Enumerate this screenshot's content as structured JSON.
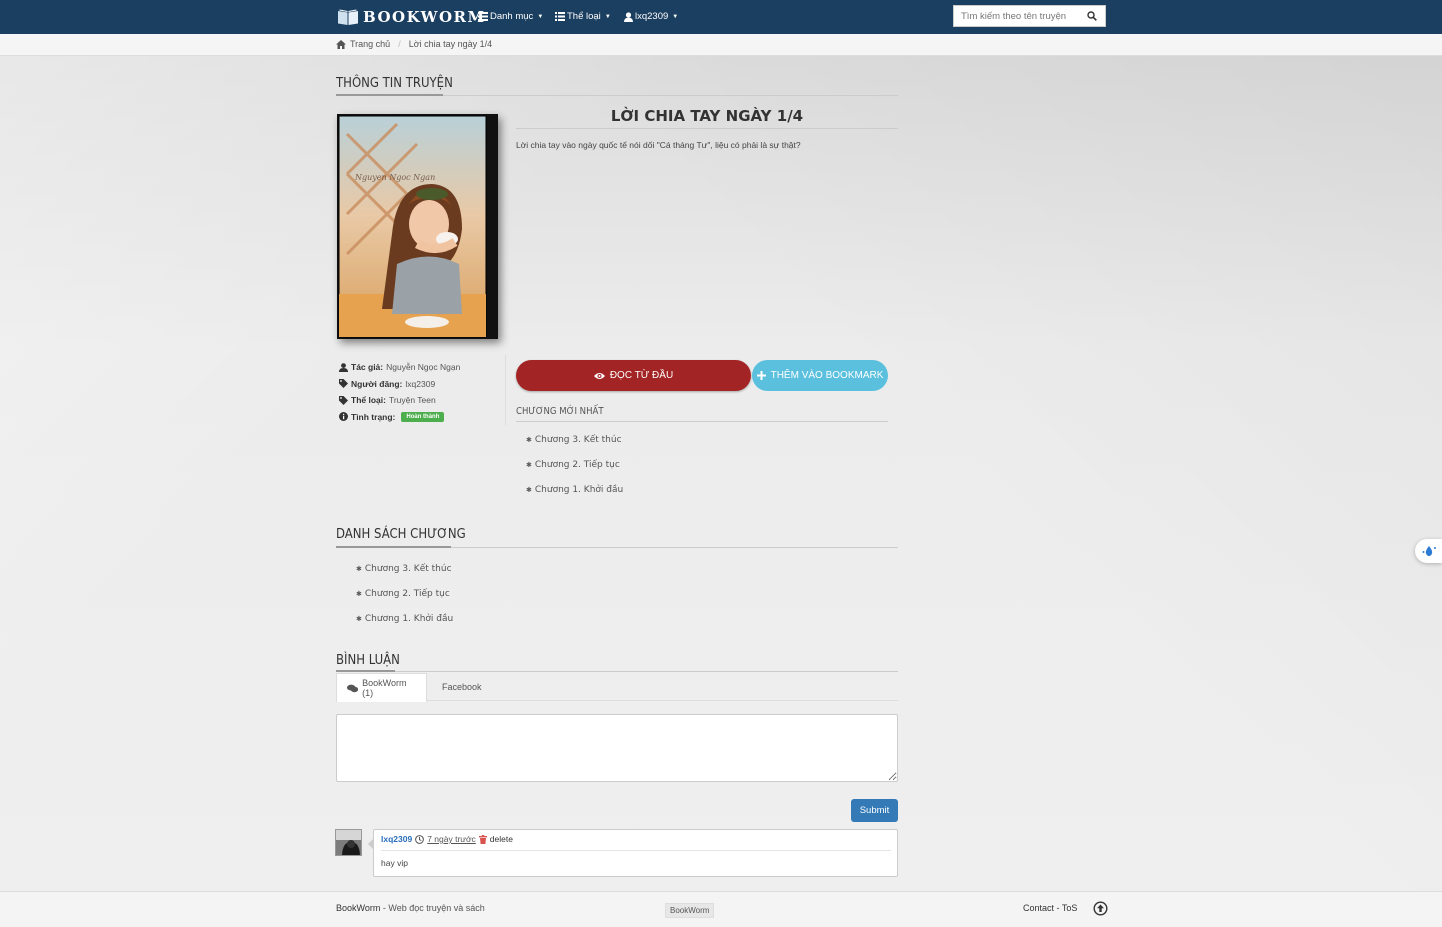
{
  "navbar": {
    "brand": "BOOKWORM",
    "menu_categories": "Danh mục",
    "menu_genres": "Thể loại",
    "menu_user": "lxq2309",
    "search_placeholder": "Tìm kiếm theo tên truyện"
  },
  "breadcrumb": {
    "home": "Trang chủ",
    "current": "Lời chia tay ngày 1/4"
  },
  "story": {
    "section_title": "THÔNG TIN TRUYỆN",
    "title": "LỜI CHIA TAY NGÀY 1/4",
    "description": "Lời chia tay vào ngày quốc tế nói dối \"Cá tháng Tư\", liệu có phải là sự thật?",
    "cover_script_text": "Nguyen Ngoc Ngan",
    "info": {
      "author_label": "Tác giả:",
      "author": "Nguyễn Ngọc Ngạn",
      "poster_label": "Người đăng:",
      "poster": "lxq2309",
      "genre_label": "Thể loại:",
      "genre": "Truyện Teen",
      "status_label": "Tình trạng:",
      "status": "Hoàn thành"
    },
    "read_button": "ĐỌC TỪ ĐẦU",
    "bookmark_button": "THÊM VÀO BOOKMARK"
  },
  "latest_chapters": {
    "title": "CHƯƠNG MỚI NHẤT",
    "items": [
      "Chương 3. Kết thúc",
      "Chương 2. Tiếp tục",
      "Chương 1. Khởi đầu"
    ]
  },
  "chapter_list": {
    "title": "DANH SÁCH CHƯƠNG",
    "items": [
      "Chương 3. Kết thúc",
      "Chương 2. Tiếp tục",
      "Chương 1. Khởi đầu"
    ]
  },
  "comments": {
    "title": "BÌNH LUẬN",
    "tab_bookworm": "BookWorm (1)",
    "tab_facebook": "Facebook",
    "submit": "Submit",
    "items": [
      {
        "user": "lxq2309",
        "time": "7 ngày trước",
        "delete": "delete",
        "text": "hay vip"
      }
    ]
  },
  "footer": {
    "brand": "BookWorm",
    "tagline": " - Web đọc truyện và sách",
    "badge": "BookWorm",
    "links": "Contact - ToS"
  },
  "colors": {
    "navbar": "#1b3f60",
    "read_button": "#a32424",
    "bookmark_button": "#5bc0de",
    "submit_button": "#337ab7",
    "status_badge": "#4cae4c"
  }
}
